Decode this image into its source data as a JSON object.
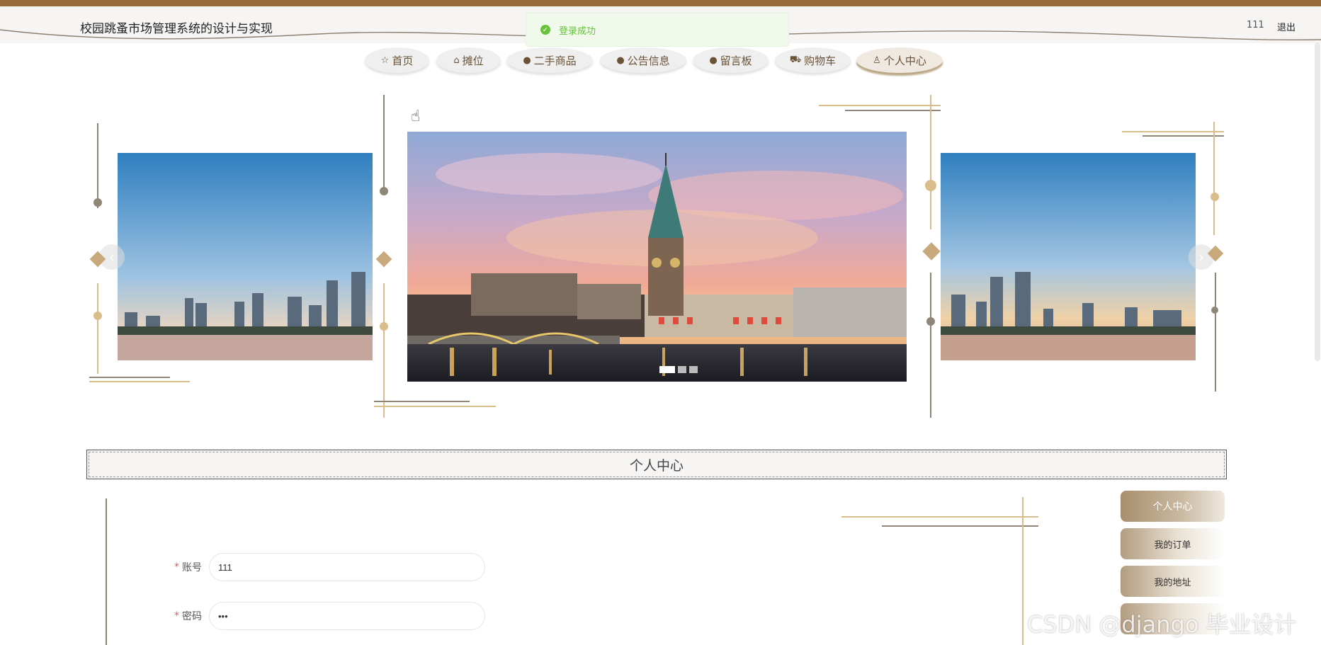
{
  "header": {
    "site_title": "校园跳蚤市场管理系统的设计与实现",
    "username": "111",
    "logout_label": "退出"
  },
  "toast": {
    "message": "登录成功",
    "icon": "success-check-icon"
  },
  "nav": {
    "items": [
      {
        "label": "首页",
        "icon": "star-icon"
      },
      {
        "label": "摊位",
        "icon": "bag-icon"
      },
      {
        "label": "二手商品",
        "icon": "info-circle-icon"
      },
      {
        "label": "公告信息",
        "icon": "question-circle-icon"
      },
      {
        "label": "留言板",
        "icon": "info-circle-icon"
      },
      {
        "label": "购物车",
        "icon": "cart-icon"
      },
      {
        "label": "个人中心",
        "icon": "user-icon"
      }
    ],
    "active_index": 6
  },
  "carousel": {
    "slides": [
      "city-skyline-dusk",
      "church-riverfront-sunset",
      "city-skyline-dusk"
    ],
    "active_index": 0,
    "indicator_count": 3
  },
  "section": {
    "title": "个人中心"
  },
  "form": {
    "account": {
      "label": "账号",
      "value": "111"
    },
    "password": {
      "label": "密码",
      "value": "•••"
    }
  },
  "side_menu": {
    "items": [
      "个人中心",
      "我的订单",
      "我的地址"
    ],
    "active_index": 0
  },
  "watermark": "CSDN @django 毕业设计",
  "colors": {
    "brand_brown": "#9a6b3b",
    "deco_gold": "#d9bd8a",
    "deco_gray": "#8f8678",
    "success_green": "#67c23a"
  }
}
